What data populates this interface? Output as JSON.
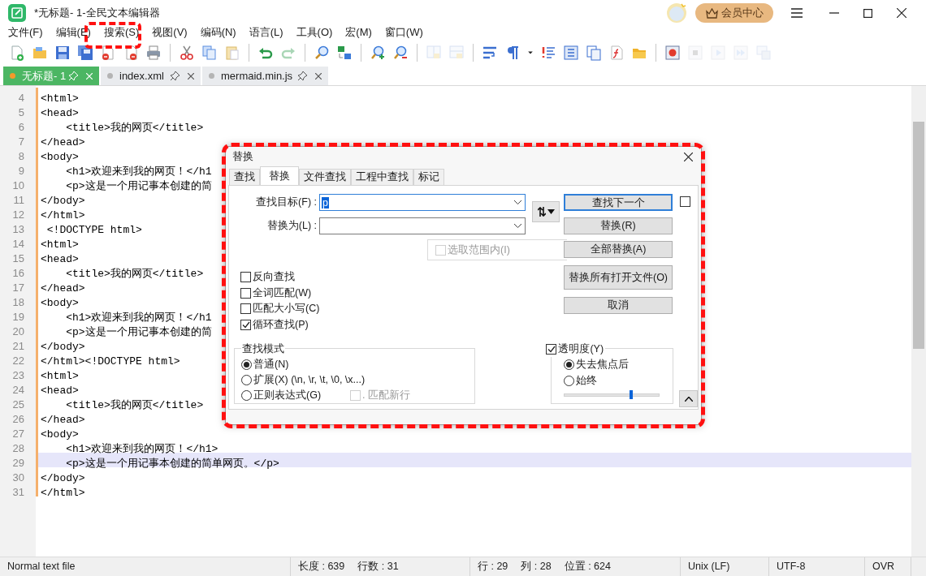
{
  "window": {
    "title": "*无标题- 1-全民文本编辑器",
    "vip_button": "会员中心"
  },
  "menu": [
    "文件(F)",
    "编辑(E)",
    "搜索(S)",
    "视图(V)",
    "编码(N)",
    "语言(L)",
    "工具(O)",
    "宏(M)",
    "窗口(W)"
  ],
  "toolbar": [
    {
      "kind": "new",
      "disabled": false
    },
    {
      "kind": "open",
      "disabled": false
    },
    {
      "kind": "save",
      "disabled": false
    },
    {
      "kind": "save-all",
      "disabled": false
    },
    {
      "kind": "close",
      "disabled": false
    },
    {
      "kind": "close-all",
      "disabled": false
    },
    {
      "kind": "print",
      "disabled": false
    },
    {
      "kind": "separator"
    },
    {
      "kind": "cut",
      "disabled": false
    },
    {
      "kind": "copy",
      "disabled": false
    },
    {
      "kind": "paste",
      "disabled": false
    },
    {
      "kind": "separator"
    },
    {
      "kind": "undo",
      "disabled": false
    },
    {
      "kind": "redo",
      "disabled": true
    },
    {
      "kind": "separator"
    },
    {
      "kind": "find",
      "disabled": false
    },
    {
      "kind": "replace",
      "disabled": false
    },
    {
      "kind": "separator"
    },
    {
      "kind": "zoom-in",
      "disabled": false
    },
    {
      "kind": "zoom-out",
      "disabled": false
    },
    {
      "kind": "separator"
    },
    {
      "kind": "sync-v",
      "disabled": true
    },
    {
      "kind": "sync-h",
      "disabled": true
    },
    {
      "kind": "separator"
    },
    {
      "kind": "wrap",
      "disabled": false
    },
    {
      "kind": "pilcrow",
      "disabled": false
    },
    {
      "kind": "dropdown",
      "disabled": false
    },
    {
      "kind": "indent-guide",
      "disabled": false
    },
    {
      "kind": "doc-map",
      "disabled": false
    },
    {
      "kind": "doc-list",
      "disabled": false
    },
    {
      "kind": "function",
      "disabled": false
    },
    {
      "kind": "folder",
      "disabled": false
    },
    {
      "kind": "separator"
    },
    {
      "kind": "record",
      "disabled": false
    },
    {
      "kind": "stop",
      "disabled": true
    },
    {
      "kind": "play",
      "disabled": true
    },
    {
      "kind": "play-multi",
      "disabled": true
    },
    {
      "kind": "save-macro",
      "disabled": true
    }
  ],
  "tabs": [
    {
      "label": "无标题- 1",
      "selected": true,
      "modified": true
    },
    {
      "label": "index.xml",
      "selected": false,
      "modified": false
    },
    {
      "label": "mermaid.min.js",
      "selected": false,
      "modified": false
    }
  ],
  "editor": {
    "lines": [
      {
        "number": "4",
        "text": "<html>",
        "current": false
      },
      {
        "number": "5",
        "text": "<head>",
        "current": false
      },
      {
        "number": "6",
        "text": "    <title>我的网页</title>",
        "current": false
      },
      {
        "number": "7",
        "text": "</head>",
        "current": false
      },
      {
        "number": "8",
        "text": "<body>",
        "current": false
      },
      {
        "number": "9",
        "text": "    <h1>欢迎来到我的网页！</h1",
        "current": false
      },
      {
        "number": "10",
        "text": "    <p>这是一个用记事本创建的简",
        "current": false
      },
      {
        "number": "11",
        "text": "</body>",
        "current": false
      },
      {
        "number": "12",
        "text": "</html>",
        "current": false
      },
      {
        "number": "13",
        "text": " <!DOCTYPE html>",
        "current": false
      },
      {
        "number": "14",
        "text": "<html>",
        "current": false
      },
      {
        "number": "15",
        "text": "<head>",
        "current": false
      },
      {
        "number": "16",
        "text": "    <title>我的网页</title>",
        "current": false
      },
      {
        "number": "17",
        "text": "</head>",
        "current": false
      },
      {
        "number": "18",
        "text": "<body>",
        "current": false
      },
      {
        "number": "19",
        "text": "    <h1>欢迎来到我的网页！</h1",
        "current": false
      },
      {
        "number": "20",
        "text": "    <p>这是一个用记事本创建的简",
        "current": false
      },
      {
        "number": "21",
        "text": "</body>",
        "current": false
      },
      {
        "number": "22",
        "text": "</html><!DOCTYPE html>",
        "current": false
      },
      {
        "number": "23",
        "text": "<html>",
        "current": false
      },
      {
        "number": "24",
        "text": "<head>",
        "current": false
      },
      {
        "number": "25",
        "text": "    <title>我的网页</title>",
        "current": false
      },
      {
        "number": "26",
        "text": "</head>",
        "current": false
      },
      {
        "number": "27",
        "text": "<body>",
        "current": false
      },
      {
        "number": "28",
        "text": "    <h1>欢迎来到我的网页！</h1>",
        "current": false
      },
      {
        "number": "29",
        "text": "    <p>这是一个用记事本创建的简单网页。</p>",
        "current": true
      },
      {
        "number": "30",
        "text": "</body>",
        "current": false
      },
      {
        "number": "31",
        "text": "</html>",
        "current": false
      }
    ]
  },
  "dialog": {
    "title": "替换",
    "tabs": [
      {
        "label": "查找",
        "selected": false
      },
      {
        "label": "替换",
        "selected": true
      },
      {
        "label": "文件查找",
        "selected": false
      },
      {
        "label": "工程中查找",
        "selected": false
      },
      {
        "label": "标记",
        "selected": false
      }
    ],
    "find_label": "查找目标(F) :",
    "find_value": "p",
    "replace_label": "替换为(L) :",
    "buttons": [
      {
        "label": "查找下一个",
        "default": true
      },
      {
        "label": "替换(R)",
        "default": false
      },
      {
        "label": "全部替换(A)",
        "default": false
      },
      {
        "label": "替换所有打开文件(O)",
        "default": false
      },
      {
        "label": "取消",
        "default": false
      }
    ],
    "side_checkbox": {
      "checked": false
    },
    "in_selection": {
      "label": "选取范围内(I)",
      "checked": false,
      "disabled": true
    },
    "options": [
      {
        "label": "反向查找",
        "checked": false
      },
      {
        "label": "全词匹配(W)",
        "checked": false
      },
      {
        "label": "匹配大小写(C)",
        "checked": false
      },
      {
        "label": "循环查找(P)",
        "checked": true
      }
    ],
    "search_mode": {
      "title": "查找模式",
      "options": [
        {
          "label": "普通(N)",
          "selected": true
        },
        {
          "label": "扩展(X) (\\n, \\r, \\t, \\0, \\x...)",
          "selected": false
        },
        {
          "label": "正则表达式(G)",
          "selected": false
        }
      ],
      "newline": {
        "label": ". 匹配新行",
        "checked": false,
        "disabled": true
      }
    },
    "transparency": {
      "label": "透明度(Y)",
      "checked": true,
      "options": [
        {
          "label": "失去焦点后",
          "selected": true
        },
        {
          "label": "始终",
          "selected": false
        }
      ],
      "level": 0.7
    }
  },
  "status_bar": [
    [
      "Normal text file"
    ],
    [
      "长度 : 639",
      "行数 : 31"
    ],
    [
      "行 : 29",
      "列 : 28",
      "位置 : 624"
    ],
    [
      "Unix (LF)"
    ],
    [
      "UTF-8"
    ],
    [
      "OVR"
    ]
  ]
}
